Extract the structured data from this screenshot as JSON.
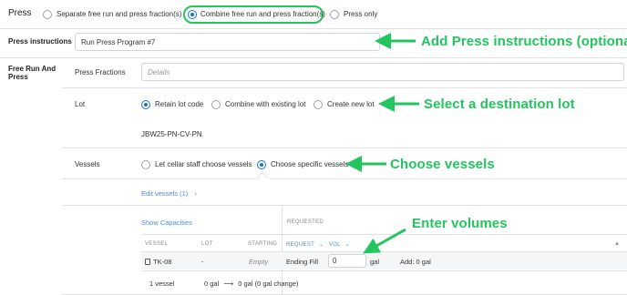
{
  "press": {
    "title": "Press",
    "options": [
      {
        "label": "Separate free run and press fraction(s)",
        "selected": false
      },
      {
        "label": "Combine free run and press fraction(s)",
        "selected": true
      },
      {
        "label": "Press only",
        "selected": false
      }
    ]
  },
  "instructions": {
    "label": "Press instructions",
    "value": "Run Press Program #7"
  },
  "free_run": {
    "label_line1": "Free Run And",
    "label_line2": "Press",
    "fractions_label": "Press Fractions",
    "fractions_placeholder": "Details"
  },
  "lot": {
    "label": "Lot",
    "options": [
      {
        "label": "Retain lot code",
        "selected": true
      },
      {
        "label": "Combine with existing lot",
        "selected": false
      },
      {
        "label": "Create new lot",
        "selected": false
      }
    ],
    "code": "JBW25-PN-CV-PN"
  },
  "vessels": {
    "label": "Vessels",
    "options": [
      {
        "label": "Let cellar staff choose vessels",
        "selected": false
      },
      {
        "label": "Choose specific vessels",
        "selected": true
      }
    ],
    "edit_link": "Edit vessels (1)",
    "show_capacities": "Show Capacities",
    "requested_header": "REQUESTED",
    "columns": {
      "vessel": "VESSEL",
      "lot": "LOT",
      "starting": "STARTING",
      "request": "REQUEST",
      "vol": "VOL"
    },
    "row": {
      "vessel": "TK-08",
      "lot": "-",
      "starting": "Empty",
      "request": "Ending Fill",
      "volume": "0",
      "unit": "gal",
      "add": "Add: 0 gal"
    },
    "footer": {
      "count": "1 vessel",
      "change": "0 gal",
      "change_after": "0 gal (0 gal change)"
    }
  },
  "annotations": {
    "instructions": "Add Press instructions (optional)",
    "lot": "Select a destination lot",
    "vessels": "Choose vessels",
    "volumes": "Enter volumes"
  },
  "colors": {
    "accent": "#1a73c8",
    "annotation": "#22c55e",
    "link": "#4a90d9"
  }
}
